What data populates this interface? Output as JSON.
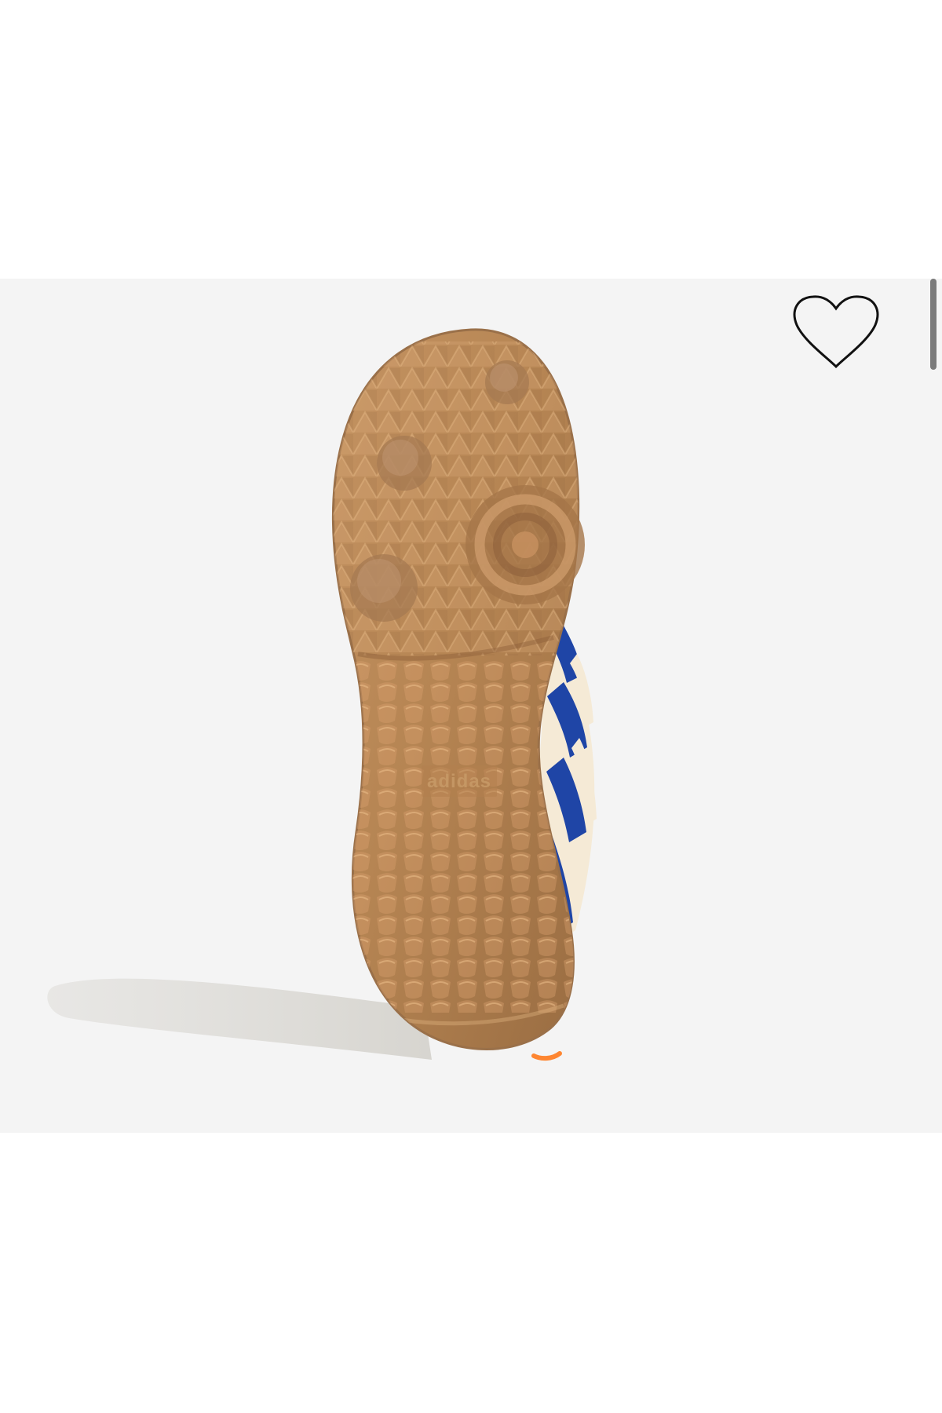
{
  "product": {
    "brand_logo_text": "adidas"
  },
  "icons": {
    "wishlist": "heart-outline-icon"
  },
  "colors": {
    "background": "#f4f4f4",
    "sole_gum": "#b88756",
    "stripe_blue": "#1f45a6",
    "upper_cream": "#f5ead6"
  }
}
